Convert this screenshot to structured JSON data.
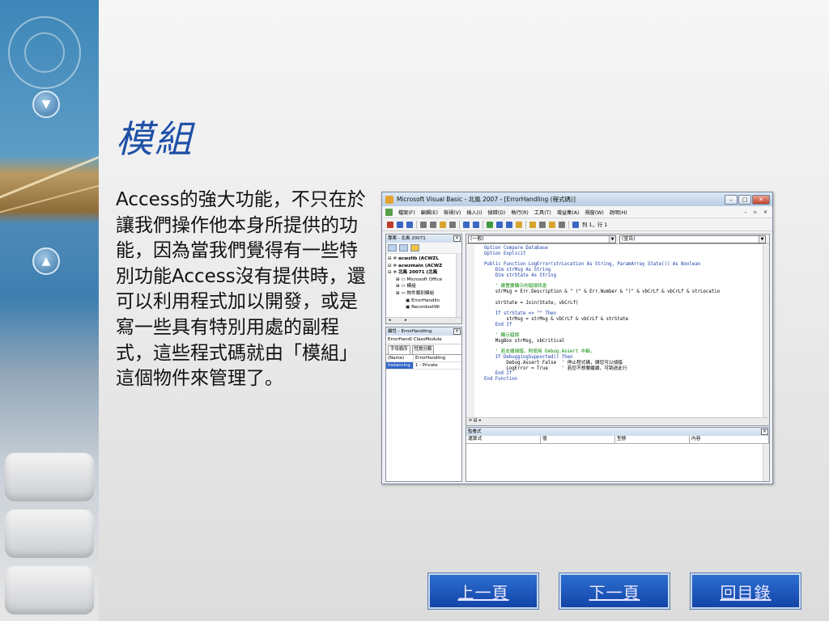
{
  "slide": {
    "title": "模組",
    "body": "Access的強大功能，不只在於讓我們操作他本身所提供的功能，因為當我們覺得有一些特別功能Access沒有提供時，還可以利用程式加以開發，或是寫一些具有特別用處的副程式，這些程式碼就由「模組」這個物件來管理了。"
  },
  "vbe": {
    "window_title": "Microsoft Visual Basic - 北風 2007 - [ErrorHandling (程式碼)]",
    "menu": [
      "檔案(F)",
      "編輯(E)",
      "檢視(V)",
      "插入(I)",
      "偵錯(D)",
      "執行(R)",
      "工具(T)",
      "增益集(A)",
      "視窗(W)",
      "說明(H)"
    ],
    "toolbar_position": "列 1，行 1",
    "project_pane": {
      "title": "專案 - 北風 20071",
      "tree": [
        {
          "level": 1,
          "text": "acwzlib (ACWZL",
          "bold": true
        },
        {
          "level": 1,
          "text": "acwzmain (ACWZ",
          "bold": true
        },
        {
          "level": 1,
          "text": "北風 20071 (北風",
          "bold": true
        },
        {
          "level": 2,
          "text": "Microsoft Office",
          "bold": false
        },
        {
          "level": 2,
          "text": "模組",
          "bold": false
        },
        {
          "level": 2,
          "text": "物件類別模組",
          "bold": false
        },
        {
          "level": 3,
          "text": "ErrorHandlin",
          "bold": false
        },
        {
          "level": 3,
          "text": "RecordsetWr",
          "bold": false
        }
      ]
    },
    "properties_pane": {
      "title": "屬性 - ErrorHandling",
      "object": "ErrorHandl ClassModule",
      "tabs": [
        "字母順序",
        "性質分類"
      ],
      "rows": [
        {
          "name": "(Name)",
          "value": "ErrorHandling"
        },
        {
          "name": "Instancing",
          "value": "1 - Private"
        }
      ]
    },
    "code_window": {
      "object_combo": "(一般)",
      "proc_combo": "(宣告)",
      "lines": [
        {
          "t": "kw",
          "s": "Option Compare Database"
        },
        {
          "t": "kw",
          "s": "Option Explicit"
        },
        {
          "t": "bl",
          "s": ""
        },
        {
          "t": "kw",
          "s": "Public Function LogError(strLocation As String, ParamArray State()) As Boolean"
        },
        {
          "t": "kw",
          "s": "    Dim strMsg As String"
        },
        {
          "t": "kw",
          "s": "    Dim strState As String"
        },
        {
          "t": "bl",
          "s": ""
        },
        {
          "t": "cm",
          "s": "    ' 建置要顯示的錯誤訊息"
        },
        {
          "t": "tx",
          "s": "    strMsg = Err.Description & \" (\" & Err.Number & \")\" & vbCrLf & vbCrLf & strLocatio"
        },
        {
          "t": "bl",
          "s": ""
        },
        {
          "t": "tx",
          "s": "    strState = Join(State, vbCrLf)"
        },
        {
          "t": "bl",
          "s": ""
        },
        {
          "t": "kw",
          "s": "    If strState <> \"\" Then"
        },
        {
          "t": "tx",
          "s": "        strMsg = strMsg & vbCrLf & vbCrLf & strState"
        },
        {
          "t": "kw",
          "s": "    End If"
        },
        {
          "t": "bl",
          "s": ""
        },
        {
          "t": "cm",
          "s": "    ' 顯示錯誤"
        },
        {
          "t": "tx",
          "s": "    MsgBox strMsg, vbCritical"
        },
        {
          "t": "bl",
          "s": ""
        },
        {
          "t": "cm",
          "s": "    ' 若支援偵錯，則使用 Debug.Assert 中斷。"
        },
        {
          "t": "kw",
          "s": "    If DebuggingSupported() Then"
        },
        {
          "t": "tx",
          "s": "        Debug.Assert False  ' 停止程式碼，讓您可以偵錯"
        },
        {
          "t": "tx",
          "s": "        LogError = True     ' 若您不想要繼續，可跳過此行"
        },
        {
          "t": "kw",
          "s": "    End If"
        },
        {
          "t": "kw",
          "s": "End Function"
        }
      ]
    },
    "watch_window": {
      "title": "監看式",
      "columns": [
        "運算式",
        "值",
        "型態",
        "內容"
      ]
    }
  },
  "nav": {
    "prev": "上一頁",
    "next": "下一頁",
    "menu": "回目錄"
  },
  "colors": {
    "title": "#1d4fa6",
    "nav_button": "#1344a8",
    "code_keyword": "#1a3ea8",
    "code_comment": "#0a8a0a"
  }
}
